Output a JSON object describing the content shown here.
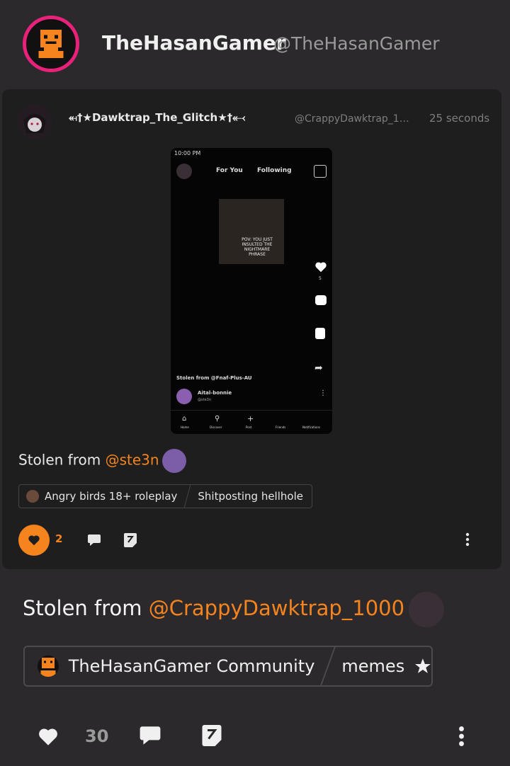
{
  "header": {
    "display_name": "TheHasanGamer",
    "handle": "@TheHasanGamer"
  },
  "repost": {
    "author_name": "⬶†★Dawktrap_The_Glitch★†⬷",
    "author_handle": "@CrappyDawktrap_1000",
    "time": "25 seconds",
    "caption_prefix": "Stolen from ",
    "caption_mention": "@ste3n",
    "tags": [
      "Angry birds 18+ roleplay",
      "Shitposting hellhole"
    ],
    "like_count": "2",
    "screenshot": {
      "status_time": "10:00 PM",
      "tab_for_you": "For You",
      "tab_following": "Following",
      "overlay_text": "POV: YOU JUST INSULTED THE NIGHTMARE PHRASE",
      "like_count": "5",
      "caption": "Stolen from @Fnaf-Plus-AU",
      "user": "Aital-bonnie",
      "user_handle": "@ste3n",
      "nav": [
        "Home",
        "Discover",
        "Post",
        "Friends",
        "Notifications"
      ]
    }
  },
  "post": {
    "caption_prefix": "Stolen from ",
    "caption_mention": "@CrappyDawktrap_1000",
    "community_tag": "TheHasanGamer Community",
    "category_tag": "memes",
    "like_count": "30"
  },
  "colors": {
    "background": "#2b292b",
    "card": "#1f1e1f",
    "accent": "#f5841f",
    "avatar_ring": "#e8227a"
  },
  "icons": [
    "heart-icon",
    "comment-icon",
    "repost-icon",
    "more-icon",
    "star-icon"
  ]
}
